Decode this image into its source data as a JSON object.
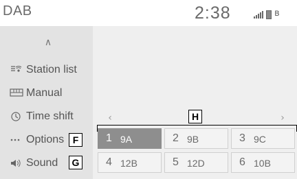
{
  "header": {
    "title": "DAB",
    "time": "2:38",
    "icons": [
      "signal-bars-icon",
      "battery-icon",
      "bluetooth-icon"
    ]
  },
  "sidebar": {
    "items": [
      {
        "label": "Station list",
        "icon": "radio-antenna-icon"
      },
      {
        "label": "Manual",
        "icon": "tuning-scale-icon"
      },
      {
        "label": "Time shift",
        "icon": "clock-icon"
      },
      {
        "label": "Options",
        "icon": "more-dots-icon"
      },
      {
        "label": "Sound",
        "icon": "speaker-icon"
      }
    ]
  },
  "callouts": {
    "F": "F",
    "G": "G",
    "H": "H"
  },
  "presets": [
    {
      "num": "1",
      "channel": "9A",
      "active": true
    },
    {
      "num": "2",
      "channel": "9B",
      "active": false
    },
    {
      "num": "3",
      "channel": "9C",
      "active": false
    },
    {
      "num": "4",
      "channel": "12B",
      "active": false
    },
    {
      "num": "5",
      "channel": "12D",
      "active": false
    },
    {
      "num": "6",
      "channel": "10B",
      "active": false
    }
  ],
  "colors": {
    "active_preset": "#8e8e8e",
    "sidebar": "#e3e3e3",
    "background": "#efefef"
  }
}
